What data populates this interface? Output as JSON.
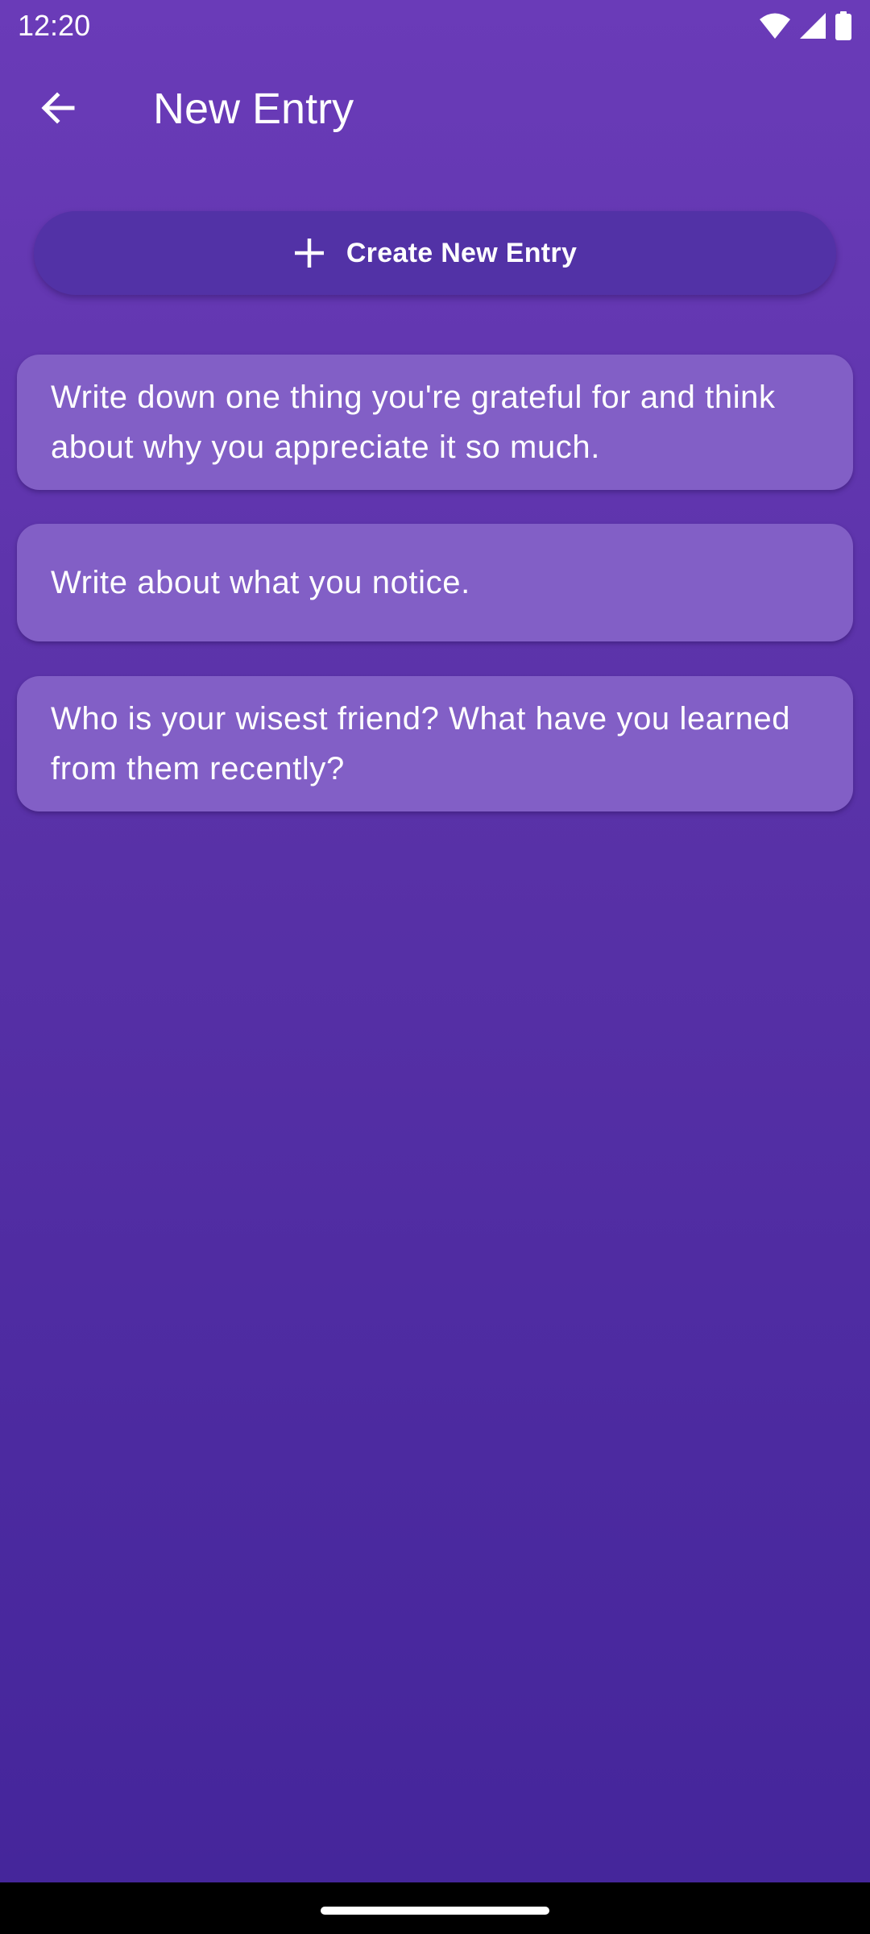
{
  "status_bar": {
    "time": "12:20",
    "icons": [
      "wifi-icon",
      "cellular-signal-icon",
      "battery-icon"
    ]
  },
  "app_bar": {
    "back_icon": "arrow-back-icon",
    "title": "New Entry"
  },
  "create_button": {
    "icon": "plus-icon",
    "label": "Create New Entry"
  },
  "prompts": [
    {
      "text": "Write down one thing you're grateful for and think about why you appreciate it so much."
    },
    {
      "text": "Write about what you notice."
    },
    {
      "text": "Who is your wisest friend? What have you learned from them recently?"
    }
  ],
  "colors": {
    "background_top": "#6a3bb8",
    "background_bottom": "#44259a",
    "button": "#5232a6",
    "card": "#825fc6",
    "text": "#ffffff"
  }
}
